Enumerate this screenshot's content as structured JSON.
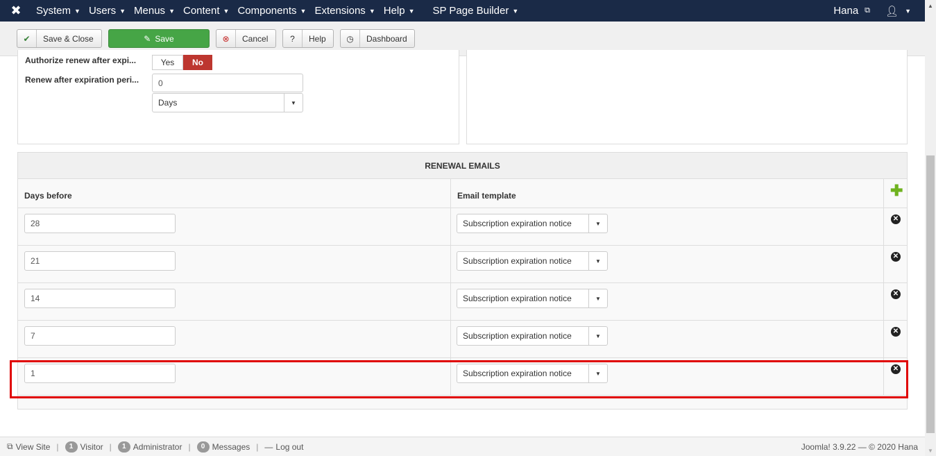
{
  "navbar": {
    "logo_icon": "joomla-logo-icon",
    "menus": [
      {
        "label": "System"
      },
      {
        "label": "Users"
      },
      {
        "label": "Menus"
      },
      {
        "label": "Content"
      },
      {
        "label": "Components"
      },
      {
        "label": "Extensions"
      },
      {
        "label": "Help"
      },
      {
        "label": "SP Page Builder"
      }
    ],
    "user_label": "Hana",
    "user_icon": "user-icon"
  },
  "toolbar": {
    "save_close_label": "Save & Close",
    "save_label": "Save",
    "cancel_label": "Cancel",
    "help_label": "Help",
    "dashboard_label": "Dashboard"
  },
  "form": {
    "authorize_renew_label": "Authorize renew after expi...",
    "yes_label": "Yes",
    "no_label": "No",
    "renew_period_label": "Renew after expiration peri...",
    "renew_period_value": "0",
    "renew_period_unit": "Days"
  },
  "renewal": {
    "title": "RENEWAL EMAILS",
    "col_days": "Days before",
    "col_template": "Email template",
    "rows": [
      {
        "days": "28",
        "template": "Subscription expiration notice"
      },
      {
        "days": "21",
        "template": "Subscription expiration notice"
      },
      {
        "days": "14",
        "template": "Subscription expiration notice"
      },
      {
        "days": "7",
        "template": "Subscription expiration notice"
      },
      {
        "days": "1",
        "template": "Subscription expiration notice"
      }
    ]
  },
  "statusbar": {
    "view_site": "View Site",
    "visitor_count": "1",
    "visitor_label": "Visitor",
    "admin_count": "1",
    "admin_label": "Administrator",
    "messages_count": "0",
    "messages_label": "Messages",
    "logout_label": "Log out",
    "version": "Joomla! 3.9.22 — © 2020 Hana"
  },
  "colors": {
    "navbar_bg": "#1a2a47",
    "save_green": "#46a546",
    "no_red": "#bd362f",
    "highlight_red": "#e00000",
    "add_green": "#6fb21f"
  }
}
